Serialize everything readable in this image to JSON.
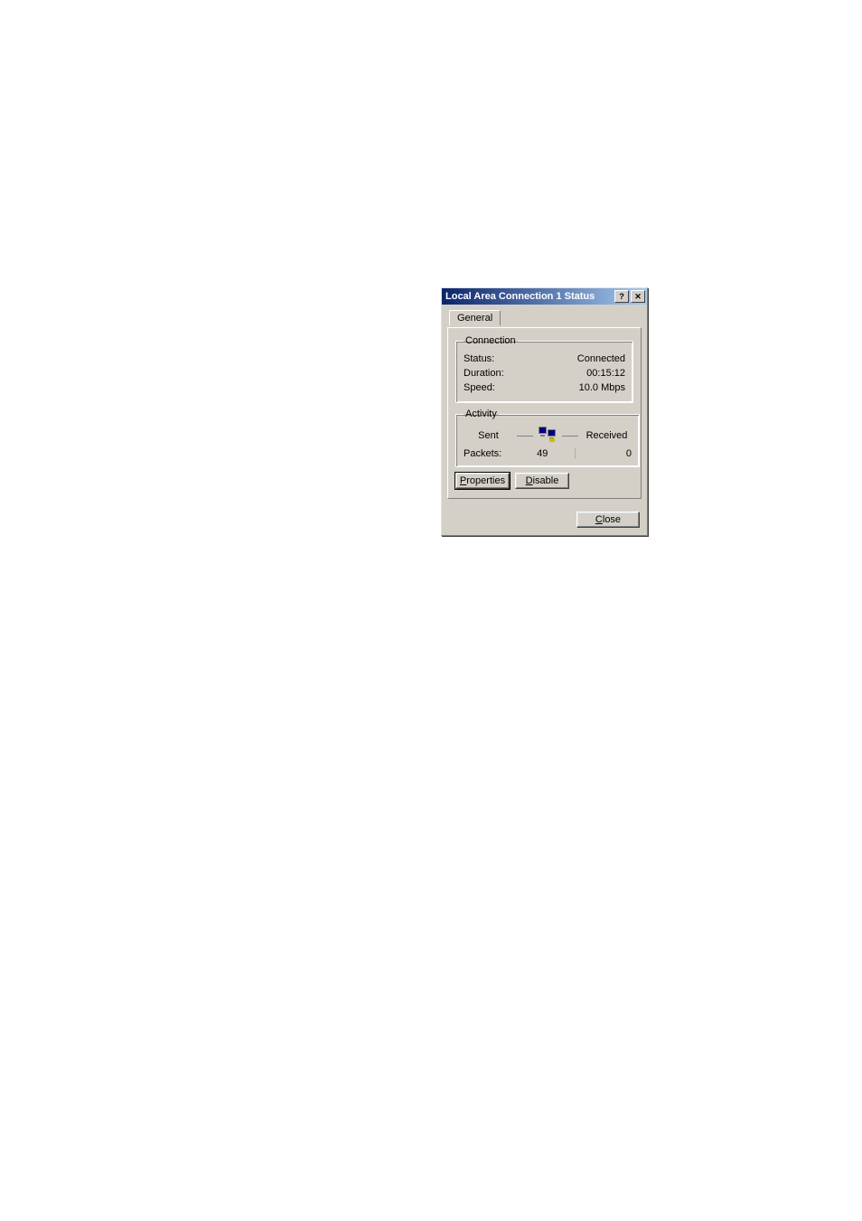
{
  "window": {
    "title": "Local Area Connection 1 Status"
  },
  "tabs": {
    "general": "General"
  },
  "connection": {
    "legend": "Connection",
    "status_label": "Status:",
    "status_value": "Connected",
    "duration_label": "Duration:",
    "duration_value": "00:15:12",
    "speed_label": "Speed:",
    "speed_value": "10.0 Mbps"
  },
  "activity": {
    "legend": "Activity",
    "sent_label": "Sent",
    "received_label": "Received",
    "packets_label": "Packets:",
    "sent_value": "49",
    "received_value": "0"
  },
  "buttons": {
    "properties": "Properties",
    "disable": "Disable",
    "close": "Close"
  }
}
